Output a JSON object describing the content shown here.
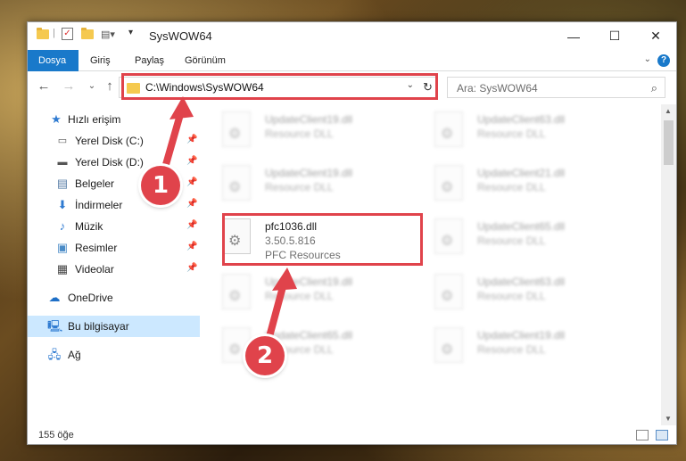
{
  "window": {
    "title": "SysWOW64",
    "minimize_glyph": "—",
    "maximize_glyph": "☐",
    "close_glyph": "✕"
  },
  "ribbon": {
    "tabs": [
      "Dosya",
      "Giriş",
      "Paylaş",
      "Görünüm"
    ],
    "help_glyph": "?"
  },
  "address": {
    "path": "C:\\Windows\\SysWOW64",
    "search_placeholder": "Ara: SysWOW64"
  },
  "nav": {
    "quick_access": "Hızlı erişim",
    "items": [
      {
        "label": "Yerel Disk (C:)",
        "icon": "drive-c-icon"
      },
      {
        "label": "Yerel Disk (D:)",
        "icon": "drive-d-icon"
      },
      {
        "label": "Belgeler",
        "icon": "documents-icon"
      },
      {
        "label": "İndirmeler",
        "icon": "downloads-icon"
      },
      {
        "label": "Müzik",
        "icon": "music-icon"
      },
      {
        "label": "Resimler",
        "icon": "pictures-icon"
      },
      {
        "label": "Videolar",
        "icon": "videos-icon"
      }
    ],
    "onedrive": "OneDrive",
    "this_pc": "Bu bilgisayar",
    "network": "Ağ"
  },
  "files": {
    "blurred_desc": "Resource DLL",
    "left": [
      "UpdateClient19.dll",
      "UpdateClient19.dll",
      "UpdateClient19.dll",
      "UpdateClient65.dll"
    ],
    "right": [
      "UpdateClient63.dll",
      "UpdateClient21.dll",
      "UpdateClient65.dll",
      "UpdateClient63.dll",
      "UpdateClient19.dll"
    ],
    "highlighted": {
      "name": "pfc1036.dll",
      "version": "3.50.5.816",
      "description": "PFC Resources"
    }
  },
  "status": {
    "item_count": "155 öğe"
  },
  "annotations": {
    "badge1": "1",
    "badge2": "2",
    "color": "#e0434b"
  }
}
